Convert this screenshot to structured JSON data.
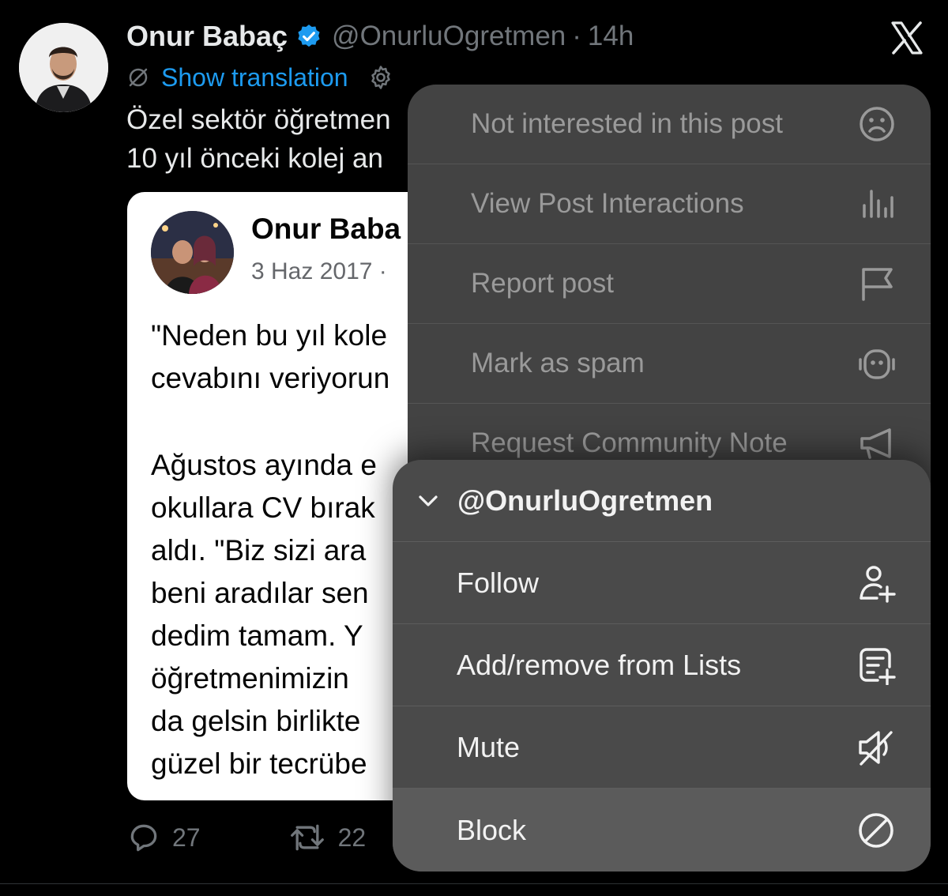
{
  "tweet": {
    "author_name": "Onur Babaç",
    "handle": "@OnurluOgretmen",
    "separator": "·",
    "time": "14h",
    "show_translation": "Show translation",
    "text_lines": [
      "Özel sektör öğretmen",
      "10 yıl önceki kolej an"
    ],
    "embed": {
      "name": "Onur Baba",
      "meta": "3 Haz 2017 ·",
      "body_lines": [
        "\"Neden bu yıl kole",
        "cevabını veriyorun",
        "",
        "Ağustos ayında e",
        "okullara CV bırak",
        "aldı. \"Biz sizi ara",
        "beni aradılar sen",
        "dedim tamam. Y",
        "öğretmenimizin",
        "da gelsin birlikte",
        "güzel bir tecrübe"
      ]
    },
    "replies": "27",
    "reposts": "22"
  },
  "menu_back": {
    "items": [
      {
        "label": "Not interested in this post",
        "icon": "sad-face-icon"
      },
      {
        "label": "View Post Interactions",
        "icon": "bar-chart-icon"
      },
      {
        "label": "Report post",
        "icon": "flag-icon"
      },
      {
        "label": "Mark as spam",
        "icon": "robot-icon"
      },
      {
        "label": "Request Community Note",
        "icon": "megaphone-icon"
      }
    ]
  },
  "menu_front": {
    "header": "@OnurluOgretmen",
    "items": [
      {
        "label": "Follow",
        "icon": "person-plus-icon"
      },
      {
        "label": "Add/remove from Lists",
        "icon": "list-add-icon"
      },
      {
        "label": "Mute",
        "icon": "mute-icon"
      },
      {
        "label": "Block",
        "icon": "block-icon"
      }
    ]
  },
  "colors": {
    "background": "#000000",
    "link": "#1d9bf0",
    "verified": "#1d9bf0",
    "muted_text": "#71767b",
    "menu_bg": "#4a4a4a"
  }
}
